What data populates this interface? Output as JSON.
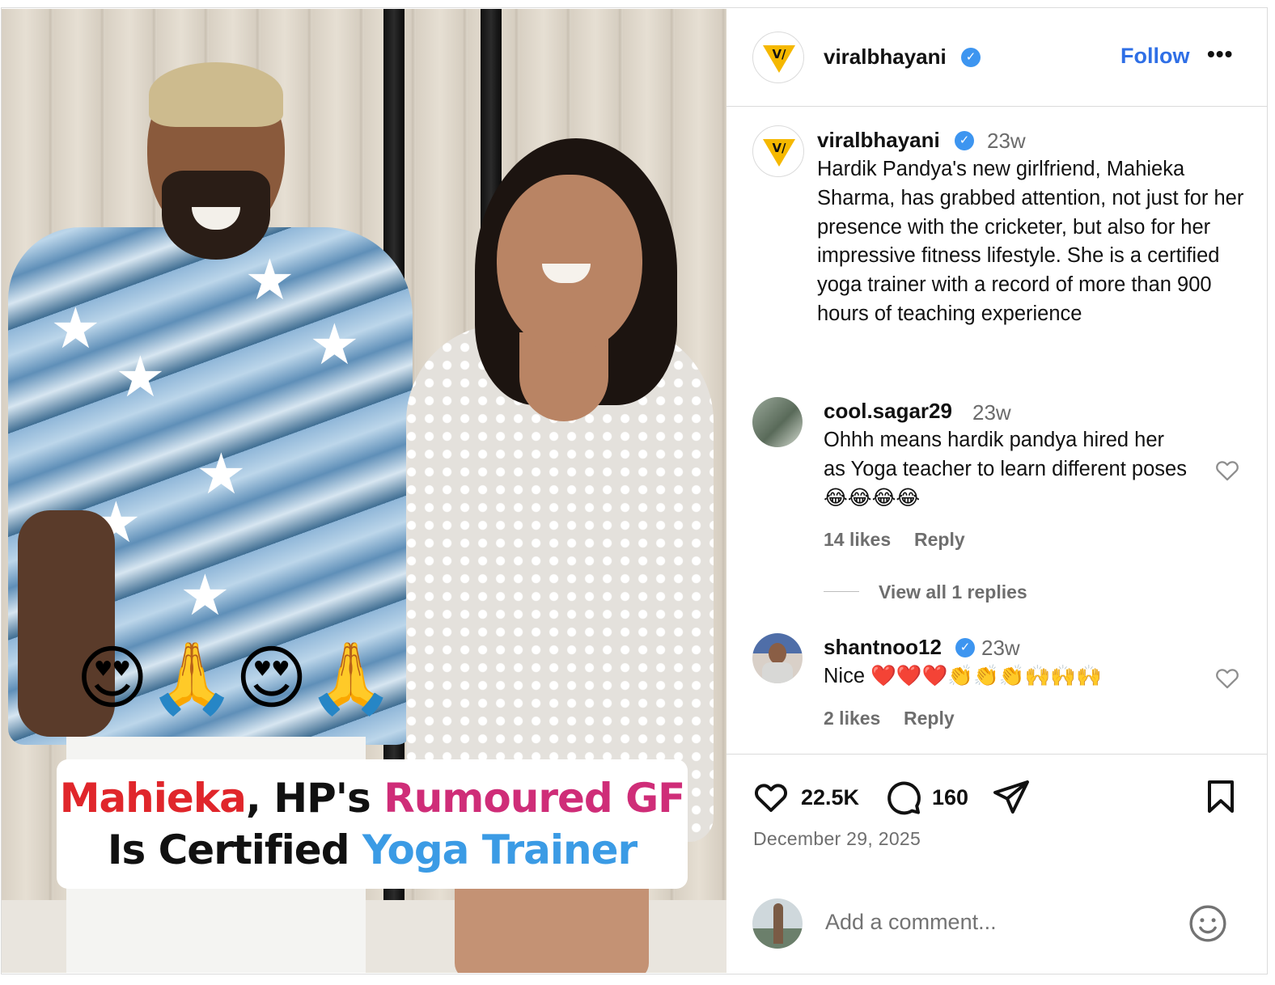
{
  "media": {
    "caption_line1": [
      {
        "text": "Mahieka",
        "style": "red"
      },
      {
        "text": ", HP's ",
        "style": "black"
      },
      {
        "text": "Rumoured GF",
        "style": "pink"
      }
    ],
    "caption_line2": [
      {
        "text": "Is Certified ",
        "style": "black"
      },
      {
        "text": "Yoga Trainer",
        "style": "blue"
      }
    ],
    "emojis": "😍🙏😍🙏"
  },
  "header": {
    "username": "viralbhayani",
    "verified_mark": "✓",
    "follow_label": "Follow",
    "more_label": "•••",
    "logo_text": "V/"
  },
  "post": {
    "username": "viralbhayani",
    "time": "23w",
    "caption": "Hardik Pandya's new girlfriend, Mahieka Sharma, has grabbed attention, not just for her presence with the cricketer, but also for her impressive fitness lifestyle. She is a certified yoga trainer with a record of more than 900 hours of teaching experience"
  },
  "comments": [
    {
      "username": "cool.sagar29",
      "time": "23w",
      "text": "Ohhh means hardik pandya hired her as Yoga teacher to learn different poses 😂😂😂😂",
      "likes": "14 likes",
      "reply_label": "Reply",
      "view_replies": "View all 1 replies"
    },
    {
      "username": "shantnoo12",
      "time": "23w",
      "text": "Nice ❤️❤️❤️👏👏👏🙌🙌🙌",
      "likes": "2 likes",
      "reply_label": "Reply"
    }
  ],
  "actions": {
    "likes_count": "22.5K",
    "comments_count": "160",
    "date": "December 29, 2025"
  },
  "composer": {
    "placeholder": "Add a comment..."
  },
  "colors": {
    "accent": "#2f6fe6",
    "verified": "#3d95f0",
    "caption_red": "#e0262b",
    "caption_pink": "#cf2d78",
    "caption_blue": "#3b9be5"
  },
  "icons": [
    "heart-icon",
    "comment-icon",
    "share-icon",
    "bookmark-icon",
    "emoji-icon",
    "verified-badge-icon",
    "more-icon"
  ]
}
